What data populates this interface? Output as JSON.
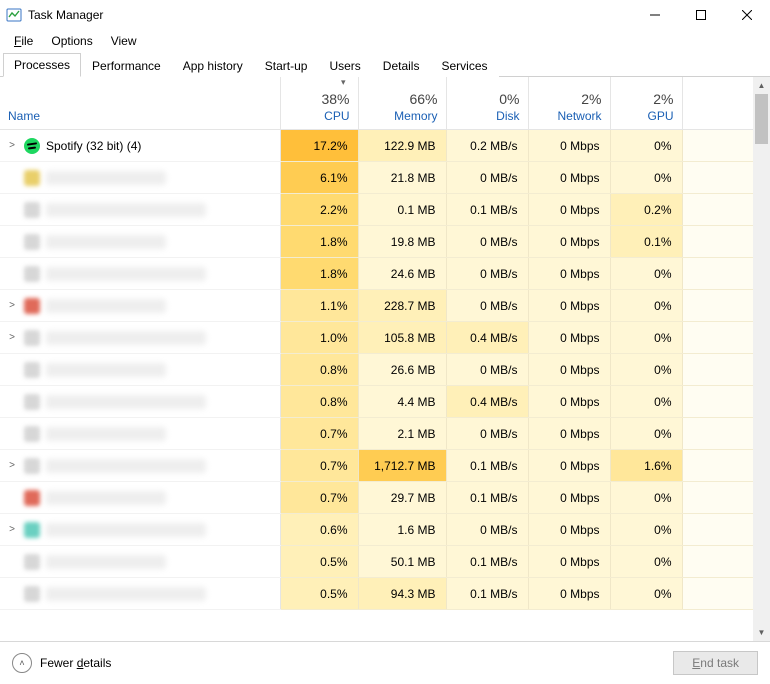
{
  "window": {
    "title": "Task Manager",
    "minimize_btn": "minimize",
    "maximize_btn": "maximize",
    "close_btn": "close"
  },
  "menubar": {
    "file": "File",
    "options": "Options",
    "view": "View"
  },
  "tabs": {
    "items": [
      {
        "label": "Processes",
        "active": true
      },
      {
        "label": "Performance",
        "active": false
      },
      {
        "label": "App history",
        "active": false
      },
      {
        "label": "Start-up",
        "active": false
      },
      {
        "label": "Users",
        "active": false
      },
      {
        "label": "Details",
        "active": false
      },
      {
        "label": "Services",
        "active": false
      }
    ]
  },
  "columns": {
    "name": {
      "label": "Name"
    },
    "cpu": {
      "pct": "38%",
      "label": "CPU",
      "sorted": true
    },
    "memory": {
      "pct": "66%",
      "label": "Memory"
    },
    "disk": {
      "pct": "0%",
      "label": "Disk"
    },
    "network": {
      "pct": "2%",
      "label": "Network"
    },
    "gpu": {
      "pct": "2%",
      "label": "GPU"
    }
  },
  "rows": [
    {
      "expand": ">",
      "icon": "spotify",
      "name": "Spotify (32 bit) (4)",
      "cpu": "17.2%",
      "mem": "122.9 MB",
      "disk": "0.2 MB/s",
      "net": "0 Mbps",
      "gpu": "0%",
      "heat": {
        "cpu": "h6",
        "mem": "h2",
        "disk": "h1",
        "net": "h1",
        "gpu": "h1"
      }
    },
    {
      "expand": "",
      "icon": "blur yellow",
      "name": "",
      "cpu": "6.1%",
      "mem": "21.8 MB",
      "disk": "0 MB/s",
      "net": "0 Mbps",
      "gpu": "0%",
      "heat": {
        "cpu": "h5",
        "mem": "h1",
        "disk": "h1",
        "net": "h1",
        "gpu": "h1"
      }
    },
    {
      "expand": "",
      "icon": "blur",
      "name": "",
      "cpu": "2.2%",
      "mem": "0.1 MB",
      "disk": "0.1 MB/s",
      "net": "0 Mbps",
      "gpu": "0.2%",
      "heat": {
        "cpu": "h4",
        "mem": "h1",
        "disk": "h1",
        "net": "h1",
        "gpu": "h2"
      }
    },
    {
      "expand": "",
      "icon": "blur",
      "name": "",
      "cpu": "1.8%",
      "mem": "19.8 MB",
      "disk": "0 MB/s",
      "net": "0 Mbps",
      "gpu": "0.1%",
      "heat": {
        "cpu": "h4",
        "mem": "h1",
        "disk": "h1",
        "net": "h1",
        "gpu": "h2"
      }
    },
    {
      "expand": "",
      "icon": "blur",
      "name": "",
      "cpu": "1.8%",
      "mem": "24.6 MB",
      "disk": "0 MB/s",
      "net": "0 Mbps",
      "gpu": "0%",
      "heat": {
        "cpu": "h4",
        "mem": "h1",
        "disk": "h1",
        "net": "h1",
        "gpu": "h1"
      }
    },
    {
      "expand": ">",
      "icon": "blur red",
      "name": "",
      "cpu": "1.1%",
      "mem": "228.7 MB",
      "disk": "0 MB/s",
      "net": "0 Mbps",
      "gpu": "0%",
      "heat": {
        "cpu": "h3",
        "mem": "h2",
        "disk": "h1",
        "net": "h1",
        "gpu": "h1"
      }
    },
    {
      "expand": ">",
      "icon": "blur",
      "name": "",
      "cpu": "1.0%",
      "mem": "105.8 MB",
      "disk": "0.4 MB/s",
      "net": "0 Mbps",
      "gpu": "0%",
      "heat": {
        "cpu": "h3",
        "mem": "h2",
        "disk": "h2",
        "net": "h1",
        "gpu": "h1"
      }
    },
    {
      "expand": "",
      "icon": "blur",
      "name": "",
      "cpu": "0.8%",
      "mem": "26.6 MB",
      "disk": "0 MB/s",
      "net": "0 Mbps",
      "gpu": "0%",
      "heat": {
        "cpu": "h3",
        "mem": "h1",
        "disk": "h1",
        "net": "h1",
        "gpu": "h1"
      }
    },
    {
      "expand": "",
      "icon": "blur",
      "name": "",
      "cpu": "0.8%",
      "mem": "4.4 MB",
      "disk": "0.4 MB/s",
      "net": "0 Mbps",
      "gpu": "0%",
      "heat": {
        "cpu": "h3",
        "mem": "h1",
        "disk": "h2",
        "net": "h1",
        "gpu": "h1"
      }
    },
    {
      "expand": "",
      "icon": "blur",
      "name": "",
      "cpu": "0.7%",
      "mem": "2.1 MB",
      "disk": "0 MB/s",
      "net": "0 Mbps",
      "gpu": "0%",
      "heat": {
        "cpu": "h3",
        "mem": "h1",
        "disk": "h1",
        "net": "h1",
        "gpu": "h1"
      }
    },
    {
      "expand": ">",
      "icon": "blur",
      "name": "",
      "cpu": "0.7%",
      "mem": "1,712.7 MB",
      "disk": "0.1 MB/s",
      "net": "0 Mbps",
      "gpu": "1.6%",
      "heat": {
        "cpu": "h3",
        "mem": "h5",
        "disk": "h1",
        "net": "h1",
        "gpu": "h3"
      }
    },
    {
      "expand": "",
      "icon": "blur red",
      "name": "",
      "cpu": "0.7%",
      "mem": "29.7 MB",
      "disk": "0.1 MB/s",
      "net": "0 Mbps",
      "gpu": "0%",
      "heat": {
        "cpu": "h3",
        "mem": "h1",
        "disk": "h1",
        "net": "h1",
        "gpu": "h1"
      }
    },
    {
      "expand": ">",
      "icon": "blur teal",
      "name": "",
      "cpu": "0.6%",
      "mem": "1.6 MB",
      "disk": "0 MB/s",
      "net": "0 Mbps",
      "gpu": "0%",
      "heat": {
        "cpu": "h2",
        "mem": "h1",
        "disk": "h1",
        "net": "h1",
        "gpu": "h1"
      }
    },
    {
      "expand": "",
      "icon": "blur",
      "name": "",
      "cpu": "0.5%",
      "mem": "50.1 MB",
      "disk": "0.1 MB/s",
      "net": "0 Mbps",
      "gpu": "0%",
      "heat": {
        "cpu": "h2",
        "mem": "h1",
        "disk": "h1",
        "net": "h1",
        "gpu": "h1"
      }
    },
    {
      "expand": "",
      "icon": "blur",
      "name": "",
      "cpu": "0.5%",
      "mem": "94.3 MB",
      "disk": "0.1 MB/s",
      "net": "0 Mbps",
      "gpu": "0%",
      "heat": {
        "cpu": "h2",
        "mem": "h2",
        "disk": "h1",
        "net": "h1",
        "gpu": "h1"
      }
    }
  ],
  "footer": {
    "fewer": "Fewer details",
    "endtask_prefix": "",
    "endtask_u": "E",
    "endtask_rest": "nd task"
  }
}
